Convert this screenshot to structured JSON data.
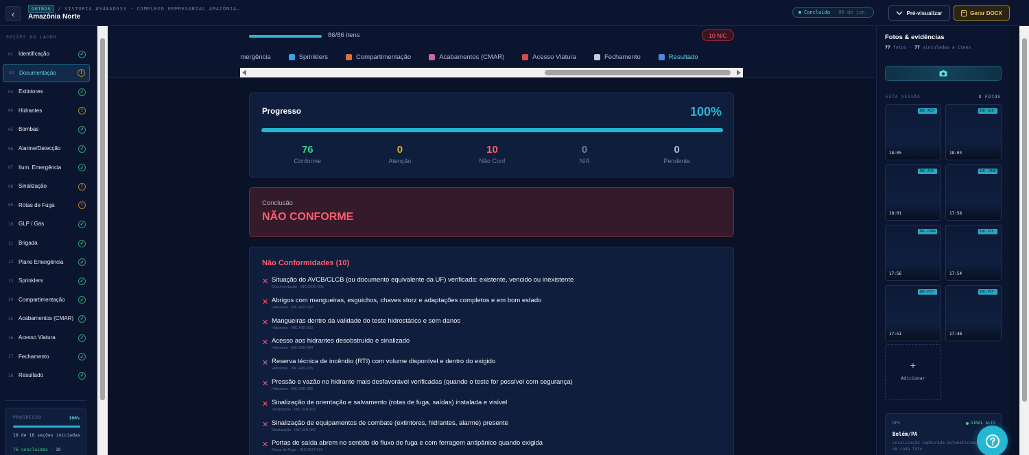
{
  "header": {
    "category_chip": "OUTROS",
    "breadcrumb_parts": [
      "/",
      "VISTORIA #948AD633",
      "·",
      "COMPLEXO EMPRESARIAL AMAZÔNIA…"
    ],
    "title": "Amazônia Norte",
    "status": "Concluída",
    "status_date": "· 06 de jun.",
    "preview_label": "Pré-visualizar",
    "docx_label": "Gerar DOCX"
  },
  "sidebar": {
    "heading": "SEÇÕES DO LAUDO",
    "items": [
      {
        "num": "01",
        "label": "Identificação",
        "status": "ok"
      },
      {
        "num": "02",
        "label": "Documentação",
        "status": "warn",
        "active": true
      },
      {
        "num": "03",
        "label": "Extintores",
        "status": "ok"
      },
      {
        "num": "04",
        "label": "Hidrantes",
        "status": "warn"
      },
      {
        "num": "05",
        "label": "Bombas",
        "status": "ok"
      },
      {
        "num": "06",
        "label": "Alarme/Detecção",
        "status": "ok"
      },
      {
        "num": "07",
        "label": "Ilum. Emergência",
        "status": "ok"
      },
      {
        "num": "08",
        "label": "Sinalização",
        "status": "warn"
      },
      {
        "num": "09",
        "label": "Rotas de Fuga",
        "status": "warn"
      },
      {
        "num": "10",
        "label": "GLP / Gás",
        "status": "ok"
      },
      {
        "num": "11",
        "label": "Brigada",
        "status": "ok"
      },
      {
        "num": "12",
        "label": "Plano Emergência",
        "status": "ok"
      },
      {
        "num": "13",
        "label": "Sprinklers",
        "status": "ok"
      },
      {
        "num": "14",
        "label": "Compartimentação",
        "status": "ok"
      },
      {
        "num": "15",
        "label": "Acabamentos (CMAR)",
        "status": "ok"
      },
      {
        "num": "16",
        "label": "Acesso Viatura",
        "status": "ok"
      },
      {
        "num": "17",
        "label": "Fechamento",
        "status": "ok"
      },
      {
        "num": "18",
        "label": "Resultado",
        "status": "ok"
      }
    ],
    "progress": {
      "label": "PROGRESSO",
      "pct": "100%",
      "sections_text": "18 de 18 seções iniciadas",
      "done_text": "76 concluídas",
      "rest_text": "· 10"
    }
  },
  "main": {
    "items_count": "86/86 itens",
    "nc_badge": "10 N/C",
    "tabs": [
      {
        "label": "Emergência",
        "icon": ""
      },
      {
        "label": "Sprinklers",
        "icon": "#3aa0e8"
      },
      {
        "label": "Compartimentação",
        "icon": "#d8733a"
      },
      {
        "label": "Acabamentos (CMAR)",
        "icon": "#c86aa0"
      },
      {
        "label": "Acesso Viatura",
        "icon": "#d84a4a"
      },
      {
        "label": "Fechamento",
        "icon": "#c9c9d9"
      },
      {
        "label": "Resultado",
        "icon": "#4a8ad8",
        "active": true
      }
    ],
    "progress_card": {
      "title": "Progresso",
      "pct": "100%",
      "stats": [
        {
          "value": "76",
          "label": "Conforme",
          "color": "#3fd08c"
        },
        {
          "value": "0",
          "label": "Atenção",
          "color": "#e3ad37"
        },
        {
          "value": "10",
          "label": "Não Conf",
          "color": "#ff5d70"
        },
        {
          "value": "0",
          "label": "N/A",
          "color": "#6c7ea3"
        },
        {
          "value": "0",
          "label": "Pendente",
          "color": "#aebbd4"
        }
      ]
    },
    "conclusion": {
      "label": "Conclusão",
      "value": "NÃO CONFORME"
    },
    "nonconformities": {
      "title": "Não Conformidades (10)",
      "items": [
        {
          "text": "Situação do AVCB/CLCB (ou documento equivalente da UF) verificada: existente, vencido ou inexistente",
          "meta": "Documentação · INC-DOC-001"
        },
        {
          "text": "Abrigos com mangueiras, esguichos, chaves storz e adaptações completos e em bom estado",
          "meta": "Hidrantes · INC-HID-002"
        },
        {
          "text": "Mangueiras dentro da validade do teste hidrostático e sem danos",
          "meta": "Hidrantes · INC-HID-003"
        },
        {
          "text": "Acesso aos hidrantes desobstruído e sinalizado",
          "meta": "Hidrantes · INC-HID-004"
        },
        {
          "text": "Reserva técnica de incêndio (RTI) com volume disponível e dentro do exigido",
          "meta": "Hidrantes · INC-HID-005"
        },
        {
          "text": "Pressão e vazão no hidrante mais desfavorável verificadas (quando o teste for possível com segurança)",
          "meta": "Hidrantes · INC-HID-006"
        },
        {
          "text": "Sinalização de orientação e salvamento (rotas de fuga, saídas) instalada e visível",
          "meta": "Sinalização · INC-SIN-001"
        },
        {
          "text": "Sinalização de equipamentos de combate (extintores, hidrantes, alarme) presente",
          "meta": "Sinalização · INC-SIN-002"
        },
        {
          "text": "Portas de saída abrem no sentido do fluxo de fuga e com ferragem antipânico quando exigida",
          "meta": "Rotas de Fuga · INC-ROT-003"
        }
      ]
    }
  },
  "photos": {
    "title": "Fotos & evidências",
    "count_total": "77",
    "count_total_label": "fotos",
    "count_linked": "77",
    "count_linked_label": "vinculadas a itens",
    "session_label": "ESTA SESSÃO",
    "session_count": "8 FOTOS",
    "items": [
      {
        "tag": "INC-ACE-",
        "time": "18:05"
      },
      {
        "tag": "INC-ACE-",
        "time": "18:03"
      },
      {
        "tag": "INC-ACE-",
        "time": "18:01"
      },
      {
        "tag": "INC-CMAR",
        "time": "17:58"
      },
      {
        "tag": "INC-CMAR",
        "time": "17:56"
      },
      {
        "tag": "INC-PCF-",
        "time": "17:54"
      },
      {
        "tag": "INC-PCF-",
        "time": "17:51"
      },
      {
        "tag": "INC-PCF-",
        "time": "17:48"
      }
    ],
    "add_label": "Adicionar",
    "gps": {
      "label": "GPS",
      "signal": "SINAL ALTO",
      "city": "Belém/PA",
      "note": "Localização capturada automaticamente em cada foto"
    }
  },
  "colors": {
    "accent": "#25b7d4",
    "ok": "#3fd08c",
    "warn": "#e3ad37",
    "danger": "#ff5d70",
    "gold": "#f1cb63"
  }
}
